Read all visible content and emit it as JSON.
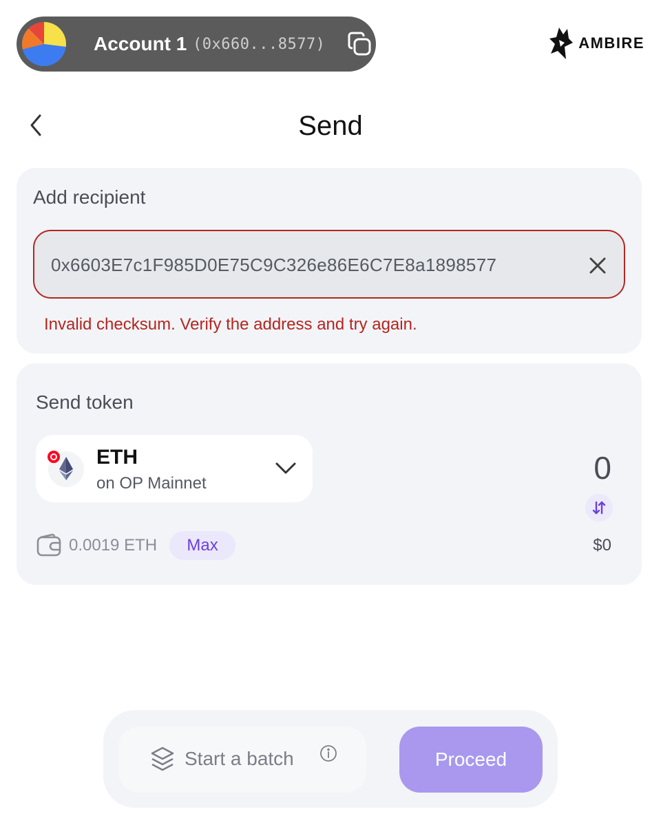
{
  "header": {
    "account_name": "Account 1",
    "account_address": "(0x660...8577)",
    "brand_name": "AMBIRE"
  },
  "page": {
    "title": "Send"
  },
  "recipient": {
    "label": "Add recipient",
    "address_value": "0x6603E7c1F985D0E75C9C326e86E6C7E8a1898577",
    "error": "Invalid checksum. Verify the address and try again."
  },
  "token": {
    "label": "Send token",
    "symbol": "ETH",
    "network": "on OP Mainnet",
    "amount": "0",
    "usd_value": "$0",
    "balance": "0.0019 ETH",
    "max_label": "Max"
  },
  "actions": {
    "batch_label": "Start a batch",
    "proceed_label": "Proceed"
  },
  "colors": {
    "error": "#b3261e",
    "accent": "#6a3fe0",
    "proceed_bg": "#a998ee",
    "card_bg": "#f2f4f8",
    "account_pill_bg": "#5b5b5b"
  }
}
